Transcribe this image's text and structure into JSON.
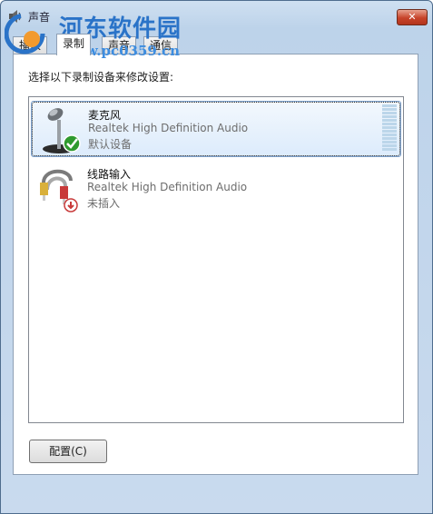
{
  "window": {
    "title": "声音",
    "close_symbol": "✕"
  },
  "watermark": {
    "text": "河东软件园",
    "url": "www.pc0359.cn"
  },
  "tabs": [
    {
      "label": "播放",
      "active": false
    },
    {
      "label": "录制",
      "active": true
    },
    {
      "label": "声音",
      "active": false
    },
    {
      "label": "通信",
      "active": false
    }
  ],
  "instruction": "选择以下录制设备来修改设置:",
  "devices": [
    {
      "name": "麦克风",
      "driver": "Realtek High Definition Audio",
      "status": "默认设备",
      "icon": "microphone-icon",
      "badge": "default-check-icon",
      "selected": true
    },
    {
      "name": "线路输入",
      "driver": "Realtek High Definition Audio",
      "status": "未插入",
      "icon": "line-in-cable-icon",
      "badge": "unplugged-icon",
      "selected": false
    }
  ],
  "configure_button": "配置(C)",
  "colors": {
    "accent": "#2a73c8",
    "selection": "#dcebfc",
    "close": "#c7432a"
  }
}
